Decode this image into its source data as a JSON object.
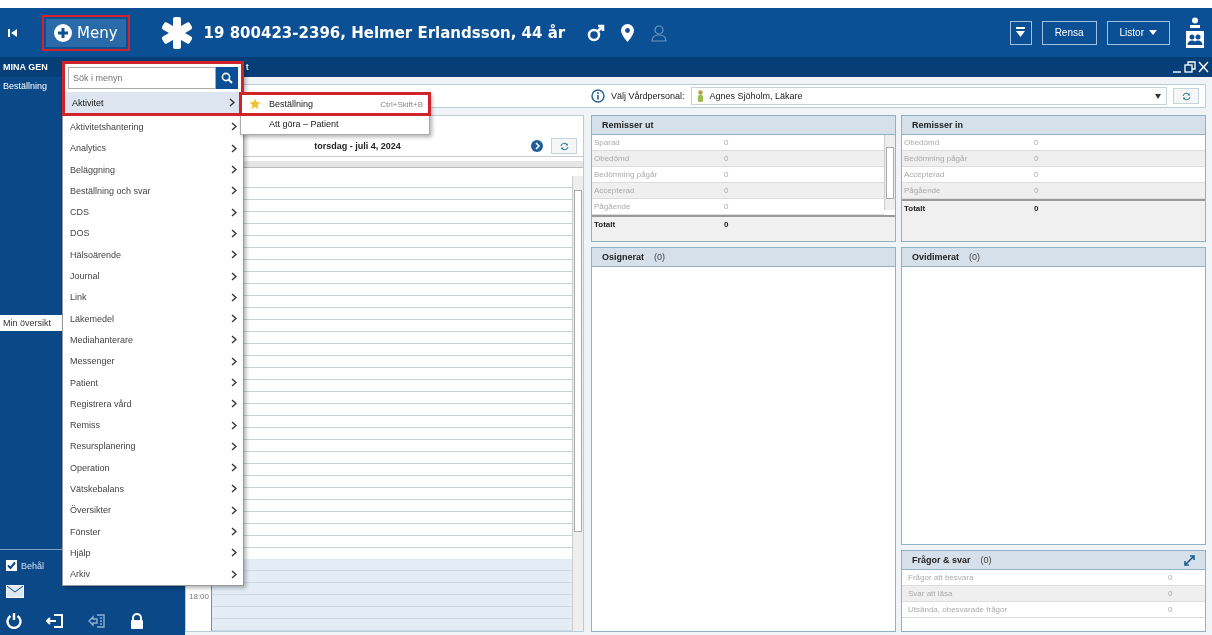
{
  "header": {
    "menu_button": "Meny",
    "patient": "19 800423-2396, Helmer Erlandsson, 44 år",
    "buttons": [
      {
        "label": "Rensa",
        "kind": "plain"
      },
      {
        "label": "Listor",
        "kind": "dropdown"
      }
    ]
  },
  "subbar": {
    "title": "MINA GEN",
    "title_fragment": "t"
  },
  "sidebar": {
    "item": "Beställning",
    "tab": "Min översikt",
    "checkbox": {
      "label": "Behål",
      "checked": true
    }
  },
  "menu": {
    "placeholder": "Sök i menyn",
    "items": [
      {
        "label": "Aktivitet",
        "selected": true
      },
      {
        "label": "Aktivitetshantering",
        "selected": false
      },
      {
        "label": "Analytics",
        "selected": false
      },
      {
        "label": "Beläggning",
        "selected": false
      },
      {
        "label": "Beställning och svar",
        "selected": false
      },
      {
        "label": "CDS",
        "selected": false
      },
      {
        "label": "DOS",
        "selected": false
      },
      {
        "label": "Hälsoärende",
        "selected": false
      },
      {
        "label": "Journal",
        "selected": false
      },
      {
        "label": "Link",
        "selected": false
      },
      {
        "label": "Läkemedel",
        "selected": false
      },
      {
        "label": "Mediahanterare",
        "selected": false
      },
      {
        "label": "Messenger",
        "selected": false
      },
      {
        "label": "Patient",
        "selected": false
      },
      {
        "label": "Registrera vård",
        "selected": false
      },
      {
        "label": "Remiss",
        "selected": false
      },
      {
        "label": "Resursplanering",
        "selected": false
      },
      {
        "label": "Operation",
        "selected": false
      },
      {
        "label": "Vätskebalans",
        "selected": false
      },
      {
        "label": "Översikter",
        "selected": false
      },
      {
        "label": "Fönster",
        "selected": false
      },
      {
        "label": "Hjälp",
        "selected": false
      },
      {
        "label": "Arkiv",
        "selected": false
      }
    ],
    "submenu": [
      {
        "label": "Beställning",
        "shortcut": "Ctrl+Skift+B",
        "starred": true,
        "selected": true
      },
      {
        "label": "Att göra – Patient",
        "starred": false,
        "selected": false
      }
    ]
  },
  "toolbar": {
    "label": "Välj Vårdpersonal:",
    "value": "Agnes Sjöholm, Läkare"
  },
  "schedule": {
    "date": "torsdag - juli 4, 2024",
    "time": "18:00"
  },
  "remisser_ut": {
    "title": "Remisser ut",
    "rows": [
      {
        "label": "Sparad",
        "value": "0"
      },
      {
        "label": "Obedömd",
        "value": "0"
      },
      {
        "label": "Bedömning pågår",
        "value": "0"
      },
      {
        "label": "Accepterad",
        "value": "0"
      },
      {
        "label": "Pågående",
        "value": "0"
      }
    ],
    "total_label": "Totalt",
    "total": "0"
  },
  "remisser_in": {
    "title": "Remisser in",
    "rows": [
      {
        "label": "Obedömd",
        "value": "0"
      },
      {
        "label": "Bedömning pågår",
        "value": "0"
      },
      {
        "label": "Accepterad",
        "value": "0"
      },
      {
        "label": "Pågående",
        "value": "0"
      }
    ],
    "total_label": "Totalt",
    "total": "0"
  },
  "osignerat": {
    "title": "Osignerat",
    "count": "(0)"
  },
  "ovidimerat": {
    "title": "Ovidimerat",
    "count": "(0)"
  },
  "fragor": {
    "title": "Frågor & svar",
    "count": "(0)",
    "rows": [
      {
        "label": "Frågor att besvara",
        "value": "0"
      },
      {
        "label": "Svar att läsa",
        "value": "0"
      },
      {
        "label": "Utsända, obesvarade frågor",
        "value": "0"
      }
    ]
  }
}
